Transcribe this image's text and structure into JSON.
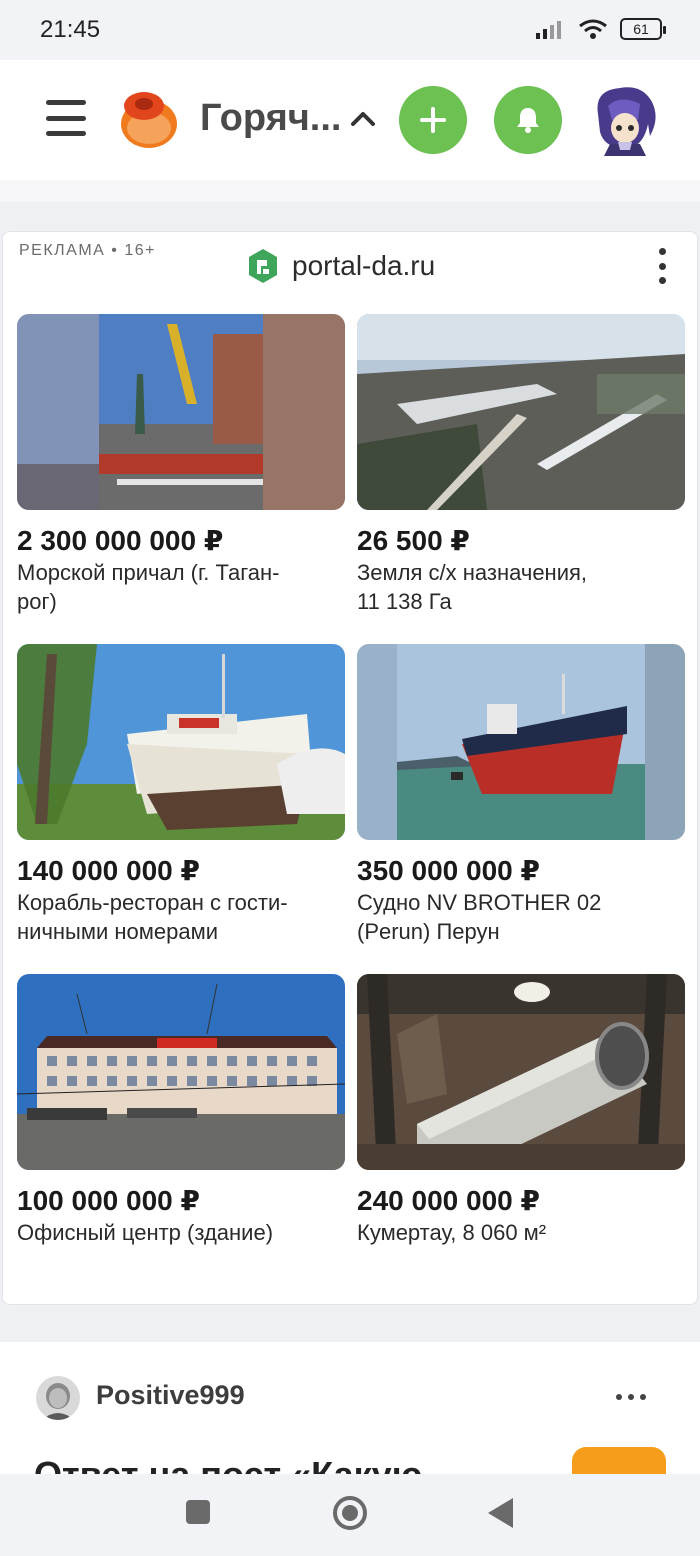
{
  "status_bar": {
    "time": "21:45",
    "battery": "61"
  },
  "header": {
    "title": "Горяч...",
    "add_icon": "plus-icon",
    "bell_icon": "bell-icon",
    "accent": "#6cc152"
  },
  "ad": {
    "label": "РЕКЛАМА • 16+",
    "source": "portal-da.ru",
    "listings": [
      {
        "price": "2 300 000 000 ₽",
        "desc_lines": [
          "Морской причал (г. Таган-",
          "рог)"
        ]
      },
      {
        "price": "26 500 ₽",
        "desc_lines": [
          "Земля с/х назначения,",
          "11 138 Га"
        ]
      },
      {
        "price": "140 000 000 ₽",
        "desc_lines": [
          "Корабль-ресторан с гости-",
          "ничными номерами"
        ]
      },
      {
        "price": "350 000 000 ₽",
        "desc_lines": [
          "Судно NV BROTHER 02",
          "(Perun) Перун"
        ]
      },
      {
        "price": "100 000 000 ₽",
        "desc_lines": [
          "Офисный центр (здание)"
        ]
      },
      {
        "price": "240 000 000 ₽",
        "desc_lines": [
          "Кумертау, 8 060 м²"
        ]
      }
    ]
  },
  "post": {
    "username": "Positive999",
    "title": "Ответ на пост «Какую"
  }
}
